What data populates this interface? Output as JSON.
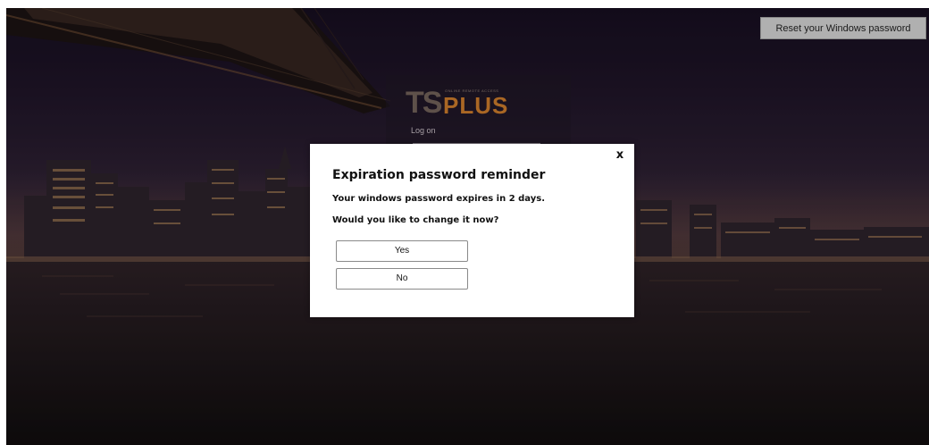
{
  "background": {
    "scene": "night-city-skyline-bridge"
  },
  "header": {
    "reset_password_label": "Reset your Windows password"
  },
  "login_panel": {
    "logo_ts": "TS",
    "logo_plus": "PLUS",
    "logo_tagline": "ONLINE REMOTE ACCESS",
    "logon_label": "Log on"
  },
  "dialog": {
    "title": "Expiration password reminder",
    "message_line1": "Your windows password expires in 2 days.",
    "message_line2": "Would you like to change it now?",
    "close_label": "x",
    "yes_label": "Yes",
    "no_label": "No"
  },
  "colors": {
    "logo_accent": "#c2762a",
    "dialog_background": "#ffffff",
    "reset_button_background": "#c9c9c9"
  }
}
